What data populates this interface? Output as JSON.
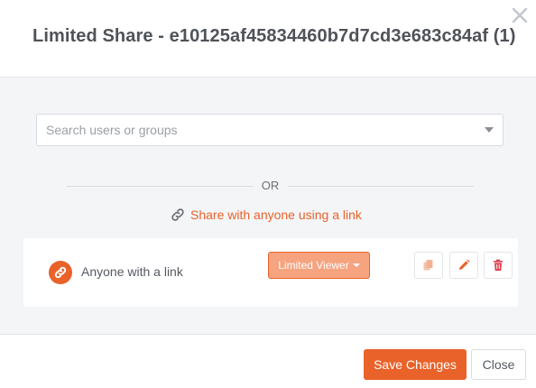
{
  "dialog": {
    "title": "Limited Share - e10125af45834460b7d7cd3e683c84af (1)",
    "close_icon": "close-x-icon"
  },
  "search": {
    "placeholder": "Search users or groups",
    "value": ""
  },
  "separator": {
    "text": "OR"
  },
  "share_link": {
    "icon": "link-icon",
    "label": "Share with anyone using a link"
  },
  "share_entry": {
    "icon": "link-avatar-icon",
    "label": "Anyone with a link",
    "role": "Limited Viewer",
    "actions": [
      {
        "name": "copy",
        "icon": "copy-icon"
      },
      {
        "name": "edit",
        "icon": "pencil-icon"
      },
      {
        "name": "delete",
        "icon": "trash-icon"
      }
    ]
  },
  "footer": {
    "save_label": "Save Changes",
    "close_label": "Close"
  },
  "colors": {
    "accent": "#e8622a",
    "accent_light": "#f6a37f",
    "delete": "#e04050",
    "body_bg": "#f4f5f7"
  }
}
